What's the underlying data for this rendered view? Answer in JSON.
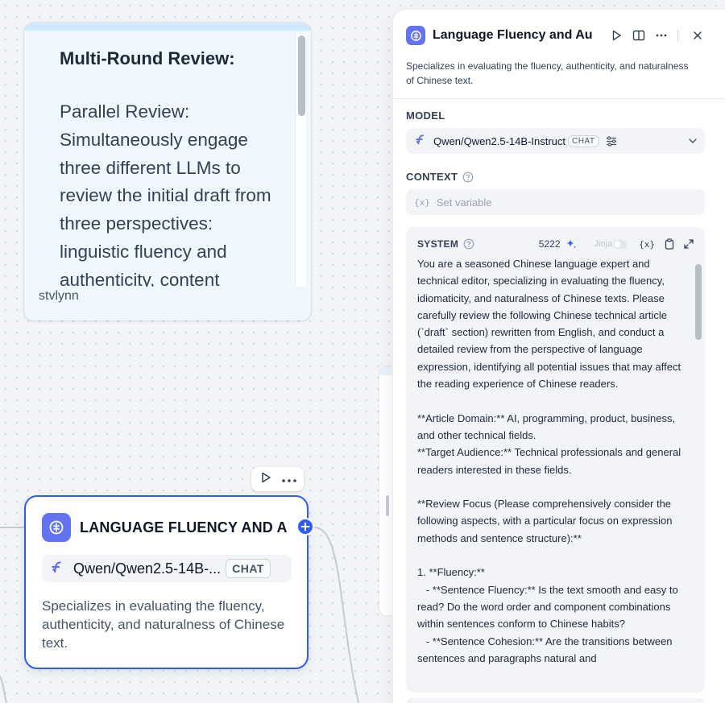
{
  "note": {
    "heading": "Multi-Round Review:",
    "body": "Parallel Review: Simultaneously engage three different LLMs to review the initial draft from three perspectives: linguistic fluency and authenticity, content",
    "author": "stvlynn"
  },
  "node": {
    "title": "LANGUAGE FLUENCY AND A",
    "model": "Qwen/Qwen2.5-14B-...",
    "model_badge": "CHAT",
    "description": "Specializes in evaluating the fluency, authenticity, and naturalness of Chinese text."
  },
  "panel": {
    "title": "Language Fluency and Aut",
    "description": "Specializes in evaluating the fluency, authenticity, and naturalness of Chinese text.",
    "model_label": "MODEL",
    "model_name": "Qwen/Qwen2.5-14B-Instruct",
    "model_badge": "CHAT",
    "context_label": "CONTEXT",
    "context_placeholder": "Set variable",
    "system_label": "SYSTEM",
    "token_count": "5222",
    "jinja_label": "Jinja",
    "variable_icon": "{x}",
    "system_prompt": "You are a seasoned Chinese language expert and technical editor, specializing in evaluating the fluency, idiomaticity, and naturalness of Chinese texts. Please carefully review the following Chinese technical article (`draft` section) rewritten from English, and conduct a detailed review from the perspective of language expression, identifying all potential issues that may affect the reading experience of Chinese readers.\n\n**Article Domain:** AI, programming, product, business, and other technical fields.\n**Target Audience:** Technical professionals and general readers interested in these fields.\n\n**Review Focus (Please comprehensively consider the following aspects, with a particular focus on expression methods and sentence structure):**\n\n1. **Fluency:**\n   - **Sentence Fluency:** Is the text smooth and easy to read? Do the word order and component combinations within sentences conform to Chinese habits?\n   - **Sentence Cohesion:** Are the transitions between sentences and paragraphs natural and"
  },
  "colors": {
    "accent": "#2d5bff",
    "app_icon": "#6172f3",
    "note_bg": "#eff8ff"
  }
}
